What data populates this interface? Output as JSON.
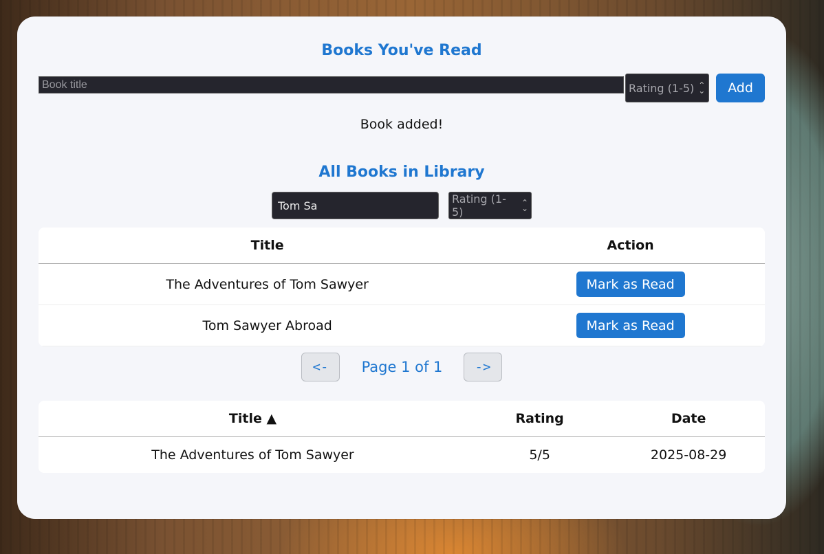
{
  "read_section": {
    "heading": "Books You've Read",
    "title_placeholder": "Book title",
    "rating_placeholder": "Rating (1-5)",
    "add_label": "Add",
    "status": "Book added!"
  },
  "library_section": {
    "heading": "All Books in Library",
    "search_value": "Tom Sa",
    "rating_placeholder": "Rating (1-5)",
    "columns": [
      "Title",
      "Action"
    ],
    "rows": [
      {
        "title": "The Adventures of Tom Sawyer",
        "action": "Mark as Read"
      },
      {
        "title": "Tom Sawyer Abroad",
        "action": "Mark as Read"
      }
    ],
    "pager": {
      "prev": "<-",
      "label": "Page 1 of 1",
      "next": "->"
    }
  },
  "read_table": {
    "columns": [
      "Title ▲",
      "Rating",
      "Date"
    ],
    "rows": [
      {
        "title": "The Adventures of Tom Sawyer",
        "rating": "5/5",
        "date": "2025-08-29"
      }
    ]
  },
  "colors": {
    "accent": "#1f77d0",
    "panel": "#f5f6fa",
    "input_bg": "#25252d"
  }
}
